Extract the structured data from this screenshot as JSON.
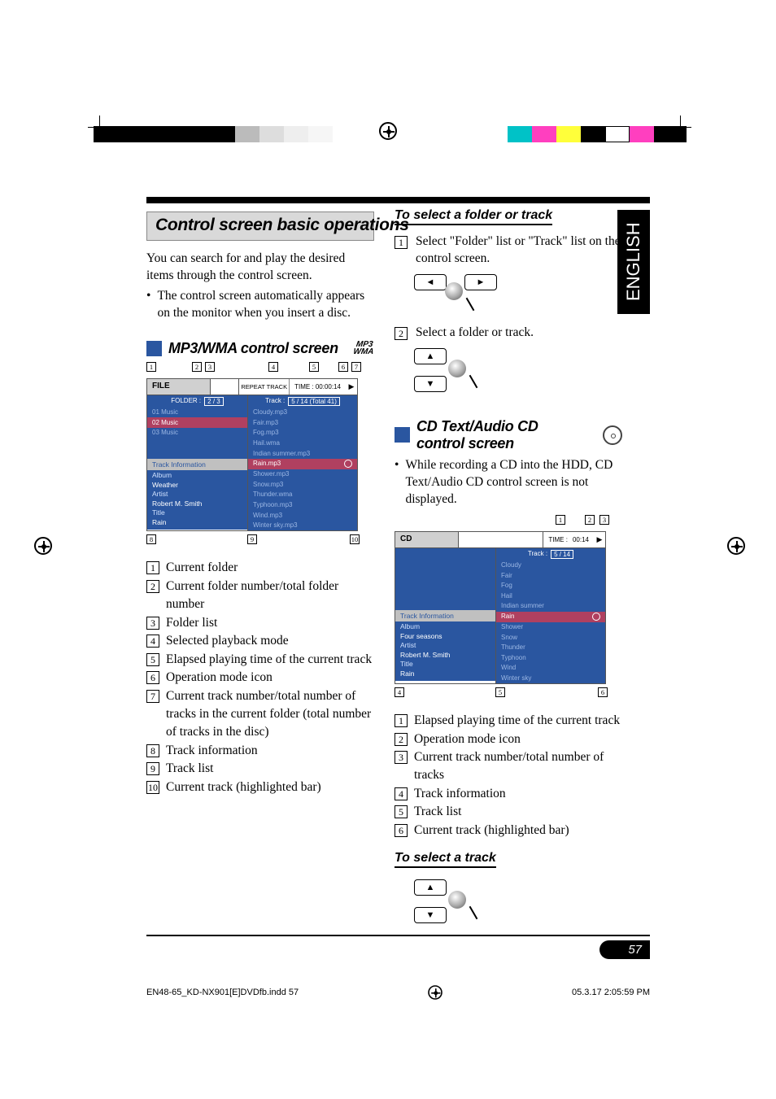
{
  "language_tab": "ENGLISH",
  "page_number": "57",
  "footer": {
    "left": "EN48-65_KD-NX901[E]DVDfb.indd   57",
    "right": "05.3.17   2:05:59 PM"
  },
  "left": {
    "title": "Control screen basic operations",
    "intro": "You can search for and play the desired items through the control screen.",
    "bullet": "The control screen automatically appears on the monitor when you insert a disc.",
    "sub1": "MP3/WMA control screen",
    "diag": {
      "file": "FILE",
      "repeat": "REPEAT TRACK",
      "time_label": "TIME :  00:00:14",
      "folder_label": "FOLDER :",
      "folder_count": "2 / 3",
      "track_label": "Track :",
      "track_count": "5 / 14 (Total 41)",
      "folders": [
        "01 Music",
        "02 Music",
        "03 Music"
      ],
      "track_info_head": "Track Information",
      "info": {
        "Album": "Weather",
        "Artist": "Robert M. Smith",
        "Title": "Rain"
      },
      "tracks": [
        "Cloudy.mp3",
        "Fair.mp3",
        "Fog.mp3",
        "Hail.wma",
        "Indian summer.mp3",
        "Rain.mp3",
        "Shower.mp3",
        "Snow.mp3",
        "Thunder.wma",
        "Typhoon.mp3",
        "Wind.mp3",
        "Winter sky.mp3"
      ],
      "highlight": 5
    },
    "legend": [
      "Current folder",
      "Current folder number/total folder number",
      "Folder list",
      "Selected playback mode",
      "Elapsed playing time of the current track",
      "Operation mode icon",
      "Current track number/total number of tracks in the current folder (total number of tracks in the disc)",
      "Track information",
      "Track list",
      "Current track (highlighted bar)"
    ]
  },
  "right": {
    "h1": "To select a folder or track",
    "step1": "Select \"Folder\" list or \"Track\" list on the control screen.",
    "step2": "Select a folder or track.",
    "sub2": "CD Text/Audio CD control screen",
    "note": "While recording a CD into the HDD, CD Text/Audio CD control screen is not displayed.",
    "diag": {
      "cd": "CD",
      "time_label": "TIME :",
      "time_value": "00:14",
      "track_label": "Track :",
      "track_count": "5 / 14",
      "track_info_head": "Track Information",
      "info": {
        "Album": "Four seasons",
        "Artist": "Robert M. Smith",
        "Title": "Rain"
      },
      "tracks": [
        "Cloudy",
        "Fair",
        "Fog",
        "Hail",
        "Indian summer",
        "Rain",
        "Shower",
        "Snow",
        "Thunder",
        "Typhoon",
        "Wind",
        "Winter sky"
      ],
      "highlight": 5
    },
    "legend": [
      "Elapsed playing time of the current track",
      "Operation mode icon",
      "Current track number/total number of tracks",
      "Track information",
      "Track list",
      "Current track (highlighted bar)"
    ],
    "h2": "To select a track"
  }
}
